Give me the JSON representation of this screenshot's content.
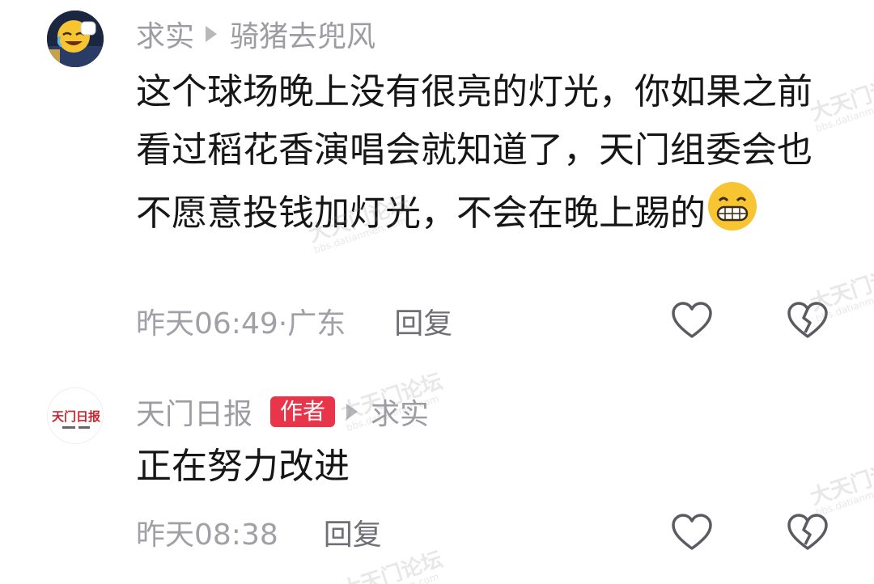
{
  "comments": [
    {
      "username": "求实",
      "reply_to": "骑猪去兜风",
      "text": "这个球场晚上没有很亮的灯光，你如果之前看过稻花香演唱会就知道了，天门组委会也不愿意投钱加灯光，不会在晚上踢的",
      "emoji": "grinning-face",
      "timestamp": "昨天06:49·广东",
      "reply_label": "回复"
    },
    {
      "username": "天门日报",
      "author_badge": "作者",
      "reply_to": "求实",
      "text": "正在努力改进",
      "timestamp": "昨天08:38",
      "reply_label": "回复"
    }
  ],
  "avatar2_text": "天门日报",
  "watermark": {
    "brand": "大天门论坛",
    "url": "bbs.datianmen.com"
  },
  "colors": {
    "meta_gray": "#9c9ca2",
    "badge_red": "#e8354a",
    "icon_gray": "#5a5a60"
  }
}
